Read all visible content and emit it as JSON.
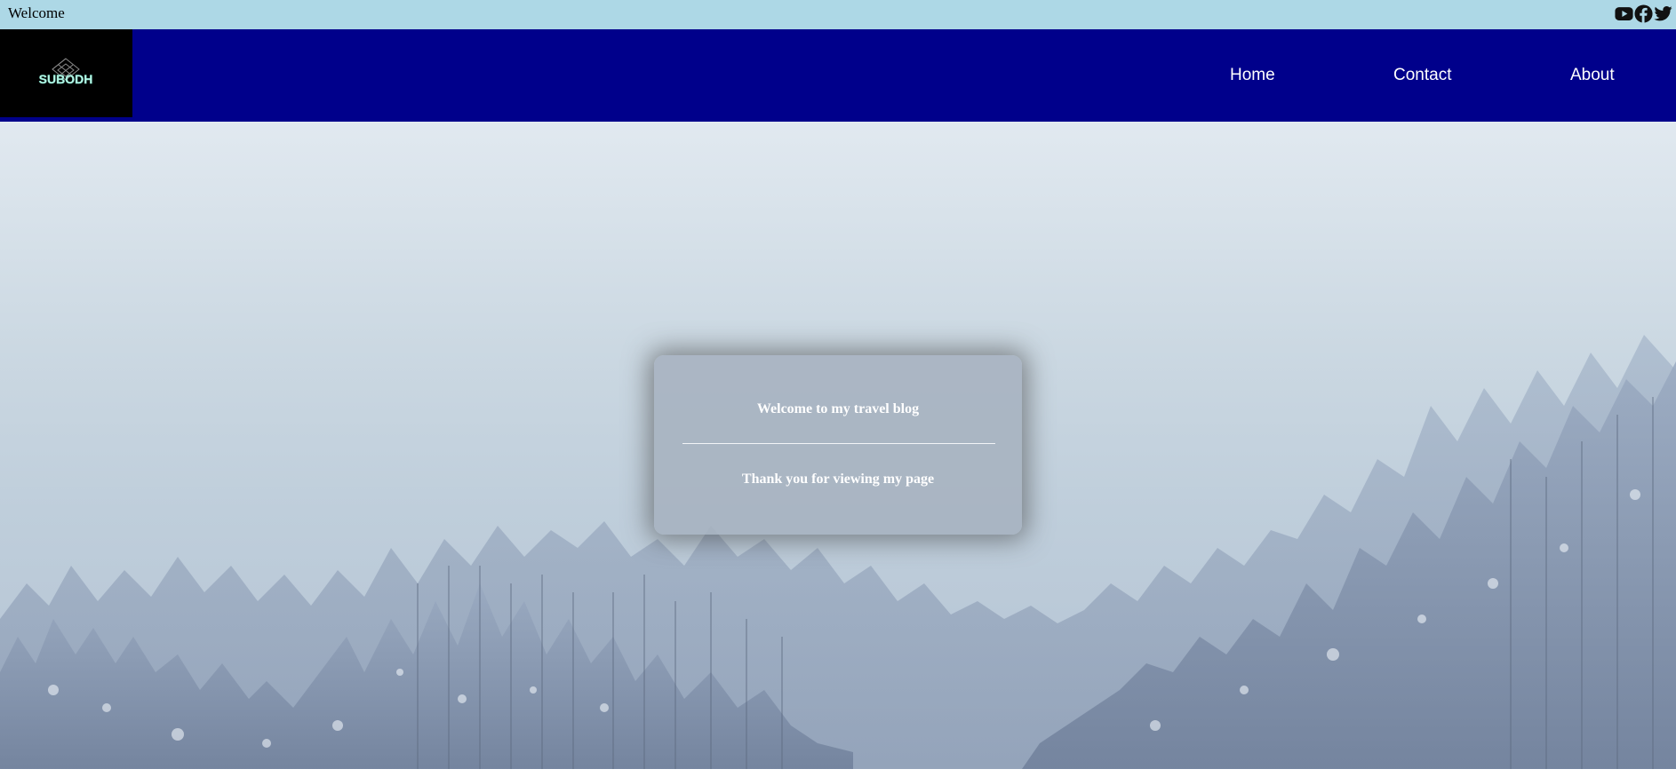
{
  "topbar": {
    "welcome_text": "Welcome",
    "background_color": "#add8e6",
    "socials": [
      {
        "icon": "youtube-icon"
      },
      {
        "icon": "facebook-icon"
      },
      {
        "icon": "twitter-icon"
      }
    ]
  },
  "navbar": {
    "background_color": "#00008b",
    "logo_text": "SUBODH",
    "links": {
      "home": "Home",
      "contact": "Contact",
      "about": "About"
    }
  },
  "hero": {
    "background": "snowy forest under a foggy sky",
    "card": {
      "title": "Welcome to my travel blog",
      "subtitle": "Thank you for viewing my page"
    }
  }
}
